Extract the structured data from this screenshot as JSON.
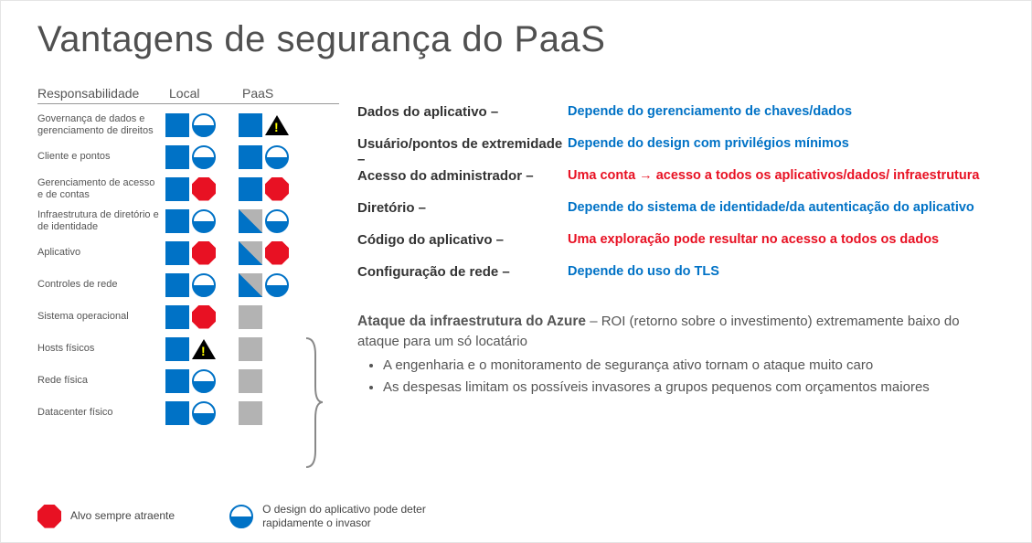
{
  "title": "Vantagens de segurança do PaaS",
  "col_headers": {
    "resp": "Responsabilidade",
    "local": "Local",
    "paas": "PaaS"
  },
  "rows": [
    {
      "label": "Governança de dados e gerenciamento de direitos",
      "local": [
        "sq-blue",
        "circ"
      ],
      "paas": [
        "sq-blue",
        "warn"
      ]
    },
    {
      "label": "Cliente e pontos",
      "local": [
        "sq-blue",
        "circ"
      ],
      "paas": [
        "sq-blue",
        "circ"
      ]
    },
    {
      "label": "Gerenciamento de acesso e de contas",
      "local": [
        "sq-blue",
        "octa"
      ],
      "paas": [
        "sq-blue",
        "octa"
      ]
    },
    {
      "label": "Infraestrutura de diretório e de identidade",
      "local": [
        "sq-blue",
        "circ"
      ],
      "paas": [
        "sq-halfblue",
        "circ"
      ]
    },
    {
      "label": "Aplicativo",
      "local": [
        "sq-blue",
        "octa"
      ],
      "paas": [
        "sq-halfblue",
        "octa"
      ]
    },
    {
      "label": "Controles de rede",
      "local": [
        "sq-blue",
        "circ"
      ],
      "paas": [
        "sq-halfblue",
        "circ"
      ]
    },
    {
      "label": "Sistema operacional",
      "local": [
        "sq-blue",
        "octa"
      ],
      "paas": [
        "sq-gray",
        ""
      ]
    },
    {
      "label": "Hosts físicos",
      "local": [
        "sq-blue",
        "warn"
      ],
      "paas": [
        "sq-gray",
        ""
      ]
    },
    {
      "label": "Rede física",
      "local": [
        "sq-blue",
        "circ"
      ],
      "paas": [
        "sq-gray",
        ""
      ]
    },
    {
      "label": "Datacenter físico",
      "local": [
        "sq-blue",
        "circ"
      ],
      "paas": [
        "sq-gray",
        ""
      ]
    }
  ],
  "details": [
    {
      "cat": "Dados do aplicativo –",
      "note": "Depende do gerenciamento de chaves/dados",
      "cls": "blue"
    },
    {
      "cat": "Usuário/pontos de extremidade –",
      "note": "Depende do design com privilégios mínimos",
      "cls": "blue"
    },
    {
      "cat": "Acesso do administrador –",
      "note": "Uma conta",
      "cls": "red",
      "extra_arrow": true,
      "extra": "acesso a todos os aplicativos/dados/ infraestrutura"
    },
    {
      "cat": "Diretório –",
      "note": "Depende do sistema de identidade/da autenticação do aplicativo",
      "cls": "blue"
    },
    {
      "cat": "Código do aplicativo –",
      "note": "Uma exploração pode resultar no acesso a todos os dados",
      "cls": "red"
    },
    {
      "cat": "Configuração de rede –",
      "note": "Depende do uso do TLS",
      "cls": "blue"
    }
  ],
  "azure": {
    "heading_bold": "Ataque da infraestrutura do Azure",
    "heading_rest": " – ROI (retorno sobre o investimento) extremamente baixo do ataque para um só locatário",
    "bullets": [
      "A engenharia e o monitoramento de segurança ativo tornam o ataque muito caro",
      "As despesas limitam os possíveis invasores a grupos pequenos com orçamentos maiores"
    ]
  },
  "legend": {
    "octa": "Alvo sempre atraente",
    "circ": "O design do aplicativo pode deter rapidamente o invasor"
  }
}
